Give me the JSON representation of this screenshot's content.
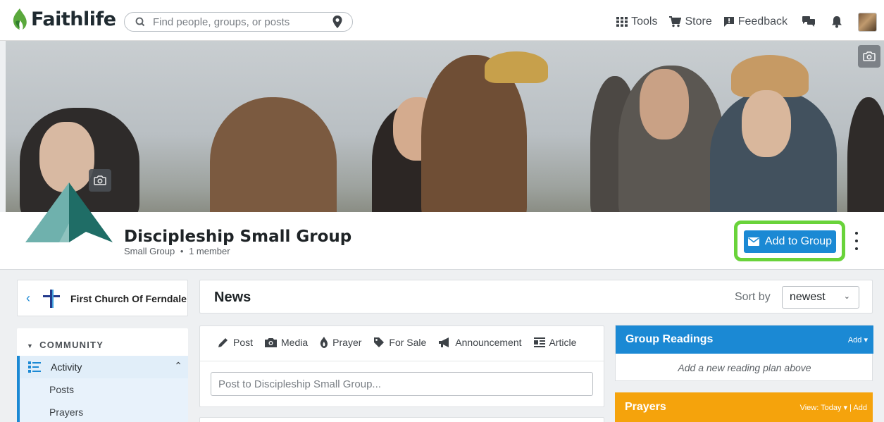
{
  "app": {
    "name": "Faithlife"
  },
  "search": {
    "placeholder": "Find people, groups, or posts"
  },
  "nav": {
    "tools": "Tools",
    "store": "Store",
    "feedback": "Feedback"
  },
  "group": {
    "name": "Discipleship Small Group",
    "type": "Small Group",
    "separator": "•",
    "members": "1 member",
    "add_button": "Add to Group"
  },
  "church": {
    "name": "First Church Of Ferndale"
  },
  "sidebar": {
    "section": "COMMUNITY",
    "active_item": "Activity",
    "sub_items": [
      "Posts",
      "Prayers"
    ]
  },
  "news": {
    "title": "News",
    "sort_label": "Sort by",
    "sort_value": "newest"
  },
  "composer": {
    "tabs": [
      "Post",
      "Media",
      "Prayer",
      "For Sale",
      "Announcement",
      "Article"
    ],
    "placeholder": "Post to Discipleship Small Group..."
  },
  "readings": {
    "title": "Group Readings",
    "action": "Add ▾",
    "empty_text": "Add a new reading plan above"
  },
  "prayers": {
    "title": "Prayers",
    "action": "View: Today ▾ | Add"
  },
  "colors": {
    "primary": "#1b89d4",
    "highlight": "#69d33a",
    "prayers": "#f5a30c",
    "logo_green": "#5aa83c",
    "logo_teal": "#1e6f6a"
  }
}
